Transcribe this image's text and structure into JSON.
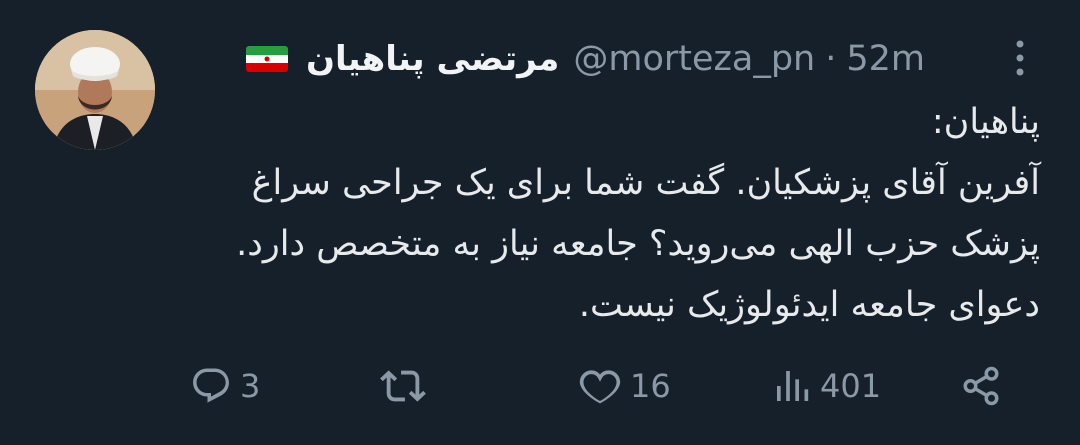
{
  "author": {
    "display_name": "مرتضی پناهیان",
    "handle": "@morteza_pn",
    "separator": "·",
    "time": "52m",
    "flag_icon": "iran-flag-icon"
  },
  "tweet": {
    "text": "پناهیان:\nآفرین آقای پزشکیان. گفت شما برای یک جراحی سراغ پزشک حزب الهی می‌روید؟ جامعه نیاز به متخصص دارد. دعوای جامعه ایدئولوژیک نیست."
  },
  "actions": {
    "replies": "3",
    "retweets": "",
    "likes": "16",
    "views": "401"
  },
  "colors": {
    "background": "#15202b",
    "text": "#e7e9ea",
    "muted": "#8b98a5"
  }
}
